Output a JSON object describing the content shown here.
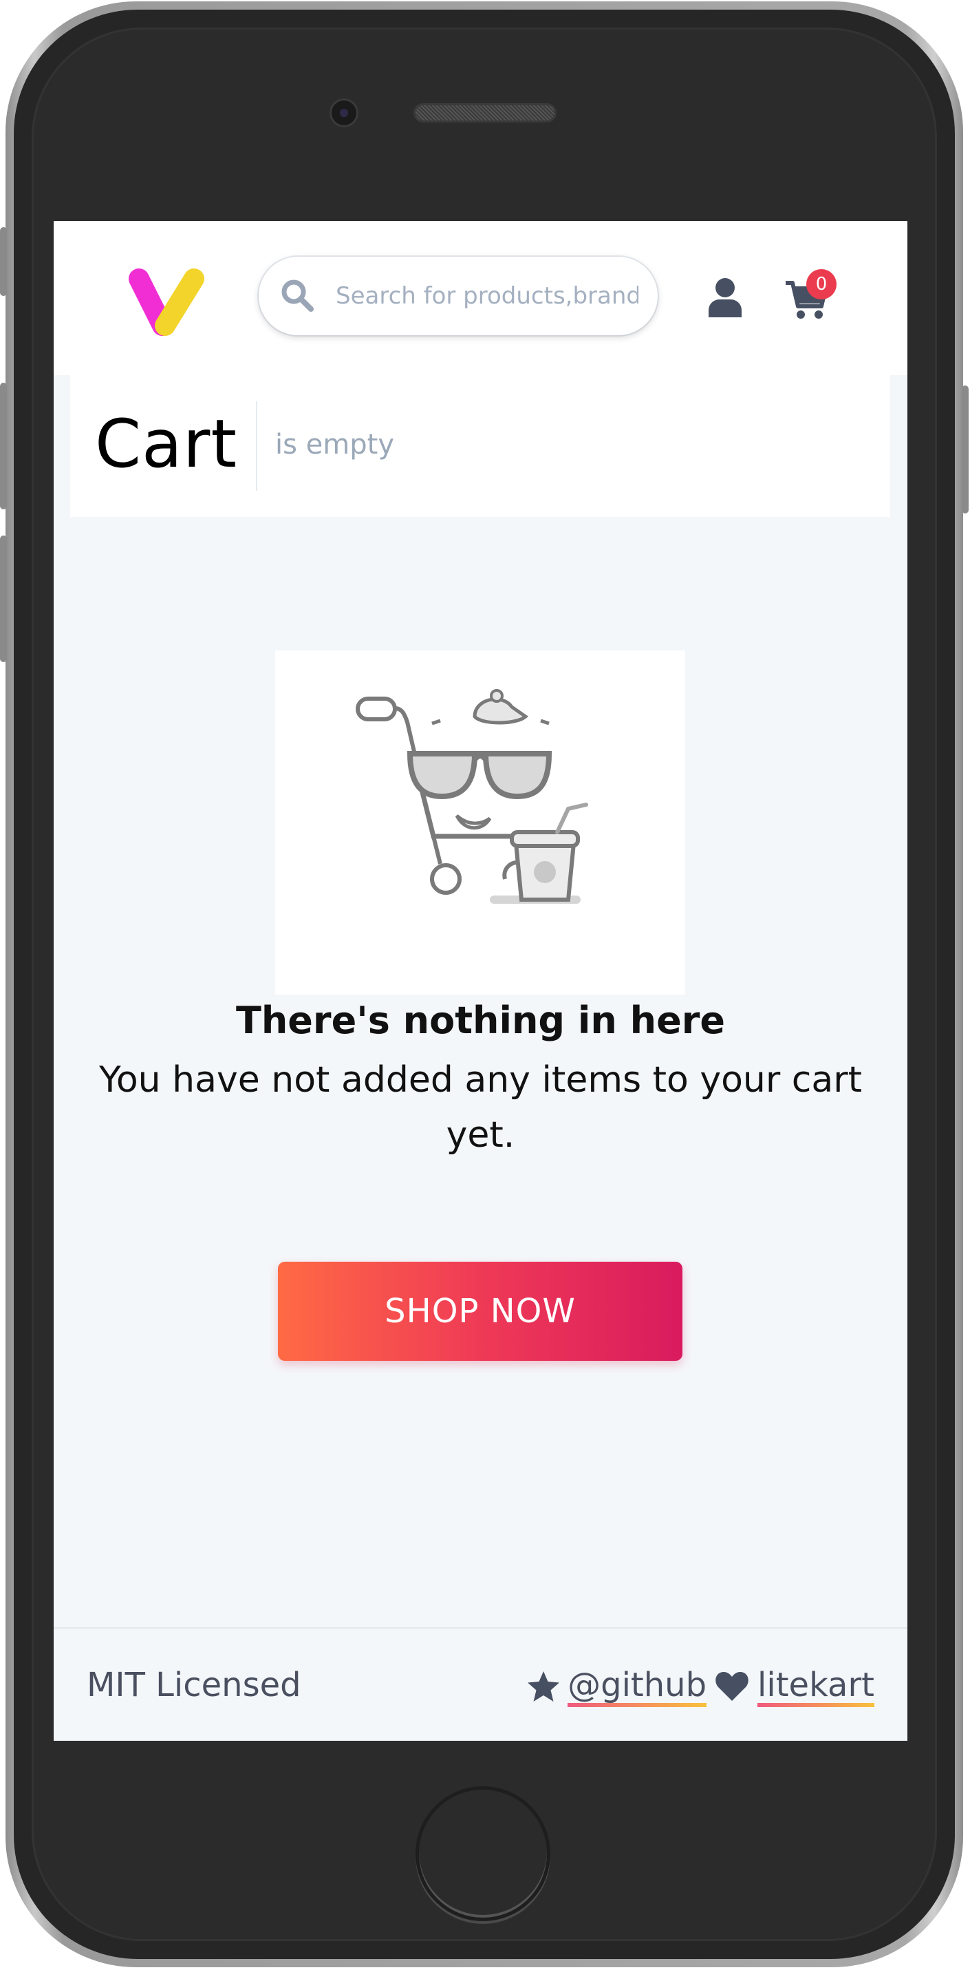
{
  "header": {
    "logo_alt": "V",
    "search": {
      "placeholder": "Search for products,brands",
      "value": ""
    },
    "cart_count": "0"
  },
  "page": {
    "title": "Cart",
    "subtitle": "is empty"
  },
  "empty_state": {
    "heading": "There's nothing in here",
    "message": "You have not added any items to your cart yet.",
    "button_label": "SHOP NOW"
  },
  "footer": {
    "license": "MIT Licensed",
    "github_link": "@github",
    "project_link": "litekart"
  },
  "colors": {
    "accent_start": "#ff6a44",
    "accent_end": "#d91b5e",
    "badge": "#ea3c4e",
    "icon": "#475063",
    "logo_pink": "#f12ed4",
    "logo_yellow": "#f2d42a"
  },
  "icons": [
    "logo-icon",
    "search-icon",
    "user-icon",
    "cart-icon",
    "empty-cart-illustration",
    "star-icon",
    "heart-icon"
  ]
}
